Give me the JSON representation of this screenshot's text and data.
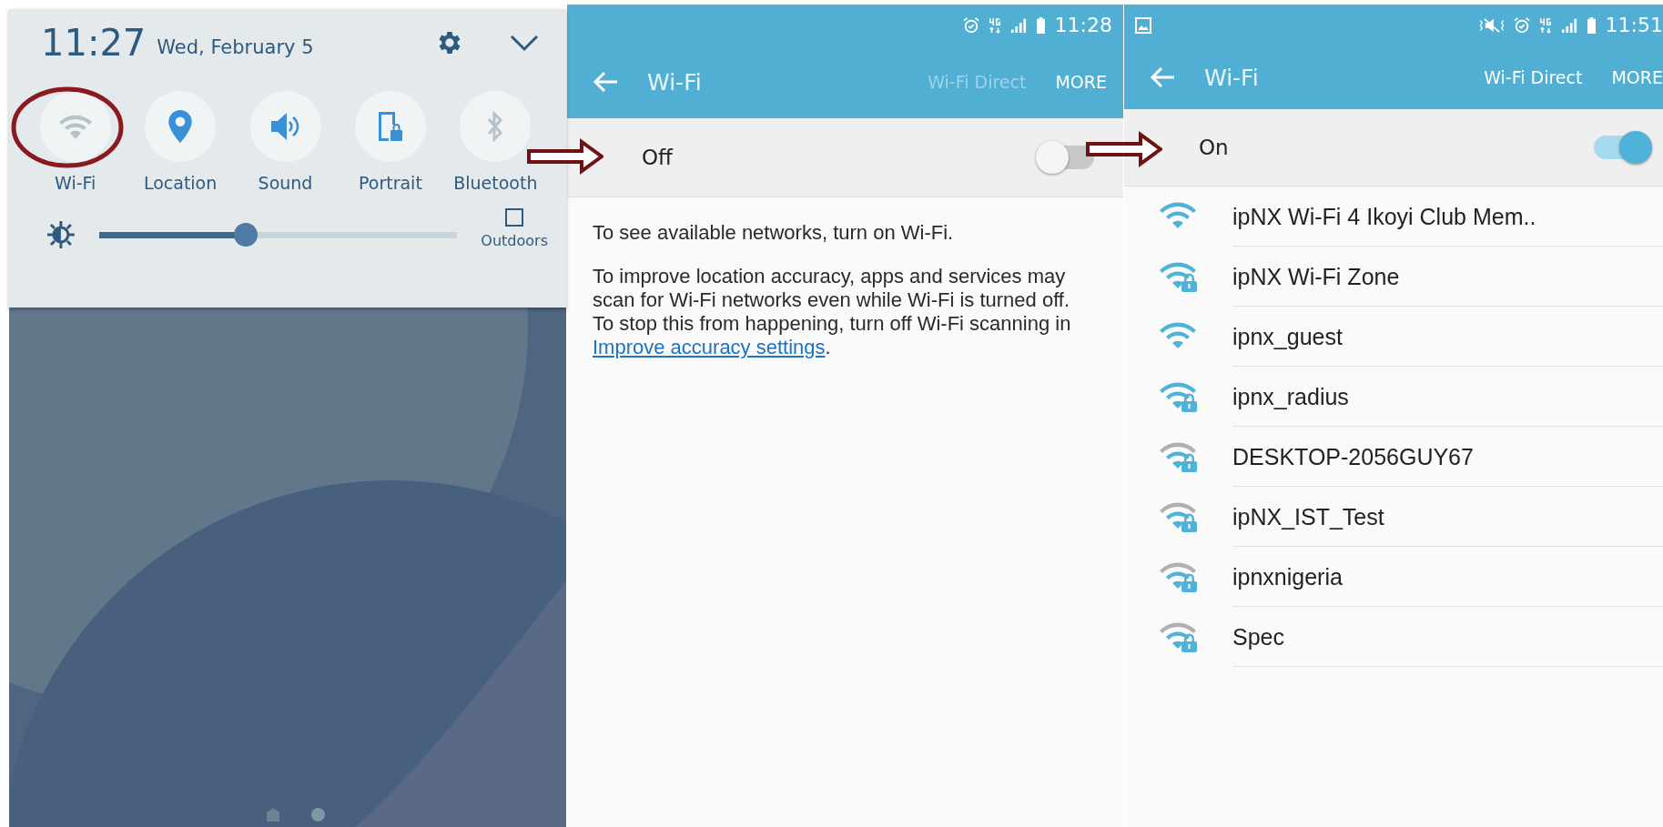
{
  "quick_panel": {
    "time": "11:27",
    "date": "Wed, February 5",
    "toggles": [
      {
        "kind": "wifi",
        "label": "Wi-Fi",
        "on": false
      },
      {
        "kind": "location",
        "label": "Location",
        "on": true
      },
      {
        "kind": "sound",
        "label": "Sound",
        "on": true
      },
      {
        "kind": "rotation",
        "label": "Portrait",
        "on": true
      },
      {
        "kind": "bluetooth",
        "label": "Bluetooth",
        "on": false
      }
    ],
    "brightness": {
      "level": 0.41
    },
    "outdoors": {
      "label": "Outdoors",
      "checked": false
    }
  },
  "screens": [
    {
      "status_icons": [
        {
          "kind": "alarm"
        },
        {
          "kind": "cellular"
        },
        {
          "kind": "signal"
        },
        {
          "kind": "battery"
        }
      ],
      "status_time": "11:28",
      "title": "Wi-Fi",
      "actions": [
        {
          "label": "Wi-Fi Direct",
          "disabled": true
        },
        {
          "label": "MORE",
          "disabled": false
        }
      ],
      "switch": {
        "label": "Off",
        "on": false
      },
      "message": "To see available networks, turn on Wi-Fi.",
      "note": {
        "text": "To improve location accuracy, apps and services may scan for Wi-Fi networks even while Wi-Fi is turned off. To stop this from happening, turn off Wi-Fi scanning in ",
        "link": "Improve accuracy settings",
        "after": "."
      }
    },
    {
      "notifications": [
        {
          "kind": "image"
        }
      ],
      "status_icons": [
        {
          "kind": "mute"
        },
        {
          "kind": "alarm"
        },
        {
          "kind": "cellular"
        },
        {
          "kind": "signal"
        },
        {
          "kind": "battery"
        }
      ],
      "status_time": "11:51",
      "title": "Wi-Fi",
      "actions": [
        {
          "label": "Wi-Fi Direct",
          "disabled": false
        },
        {
          "label": "MORE",
          "disabled": false
        }
      ],
      "switch": {
        "label": "On",
        "on": true
      },
      "networks": [
        {
          "name": "ipNX Wi-Fi 4 Ikoyi Club Mem..",
          "secured": false,
          "weak": false
        },
        {
          "name": "ipNX Wi-Fi Zone",
          "secured": true,
          "weak": false
        },
        {
          "name": "ipnx_guest",
          "secured": false,
          "weak": false
        },
        {
          "name": "ipnx_radius",
          "secured": true,
          "weak": false
        },
        {
          "name": "DESKTOP-2056GUY67",
          "secured": true,
          "weak": true
        },
        {
          "name": "ipNX_IST_Test",
          "secured": true,
          "weak": true
        },
        {
          "name": "ipnxnigeria",
          "secured": true,
          "weak": true
        },
        {
          "name": "Spec",
          "secured": true,
          "weak": true
        }
      ]
    }
  ]
}
